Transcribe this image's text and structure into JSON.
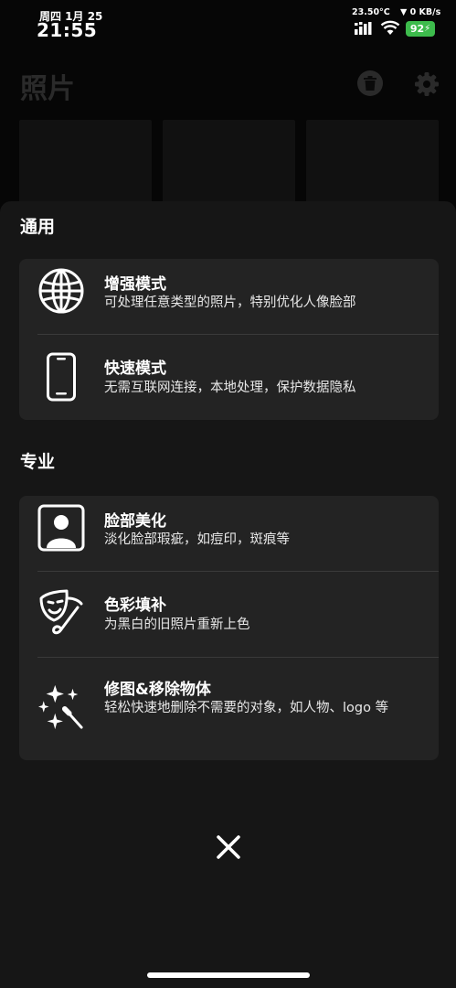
{
  "status_bar": {
    "date": "周四 1月 25",
    "time": "21:55",
    "temperature": "23.50°C",
    "network_speed": "▼ 0 KB/s",
    "battery": "92",
    "icons": [
      "signal-icon",
      "wifi-icon",
      "battery-charging-icon"
    ]
  },
  "app": {
    "title": "照片",
    "toolbar_icons": [
      "trash-icon",
      "gear-icon"
    ]
  },
  "sheet": {
    "sections": [
      {
        "title": "通用",
        "items": [
          {
            "icon": "globe-icon",
            "title": "增强模式",
            "desc": "可处理任意类型的照片，特别优化人像脸部"
          },
          {
            "icon": "phone-icon",
            "title": "快速模式",
            "desc": "无需互联网连接，本地处理，保护数据隐私"
          }
        ]
      },
      {
        "title": "专业",
        "items": [
          {
            "icon": "portrait-icon",
            "title": "脸部美化",
            "desc": "淡化脸部瑕疵，如痘印，斑痕等"
          },
          {
            "icon": "palette-mask-icon",
            "title": "色彩填补",
            "desc": "为黑白的旧照片重新上色"
          },
          {
            "icon": "magic-wand-icon",
            "title": "修图&移除物体",
            "desc": "轻松快速地删除不需要的对象，如人物、logo 等"
          }
        ]
      }
    ],
    "close_icon": "close-icon"
  }
}
